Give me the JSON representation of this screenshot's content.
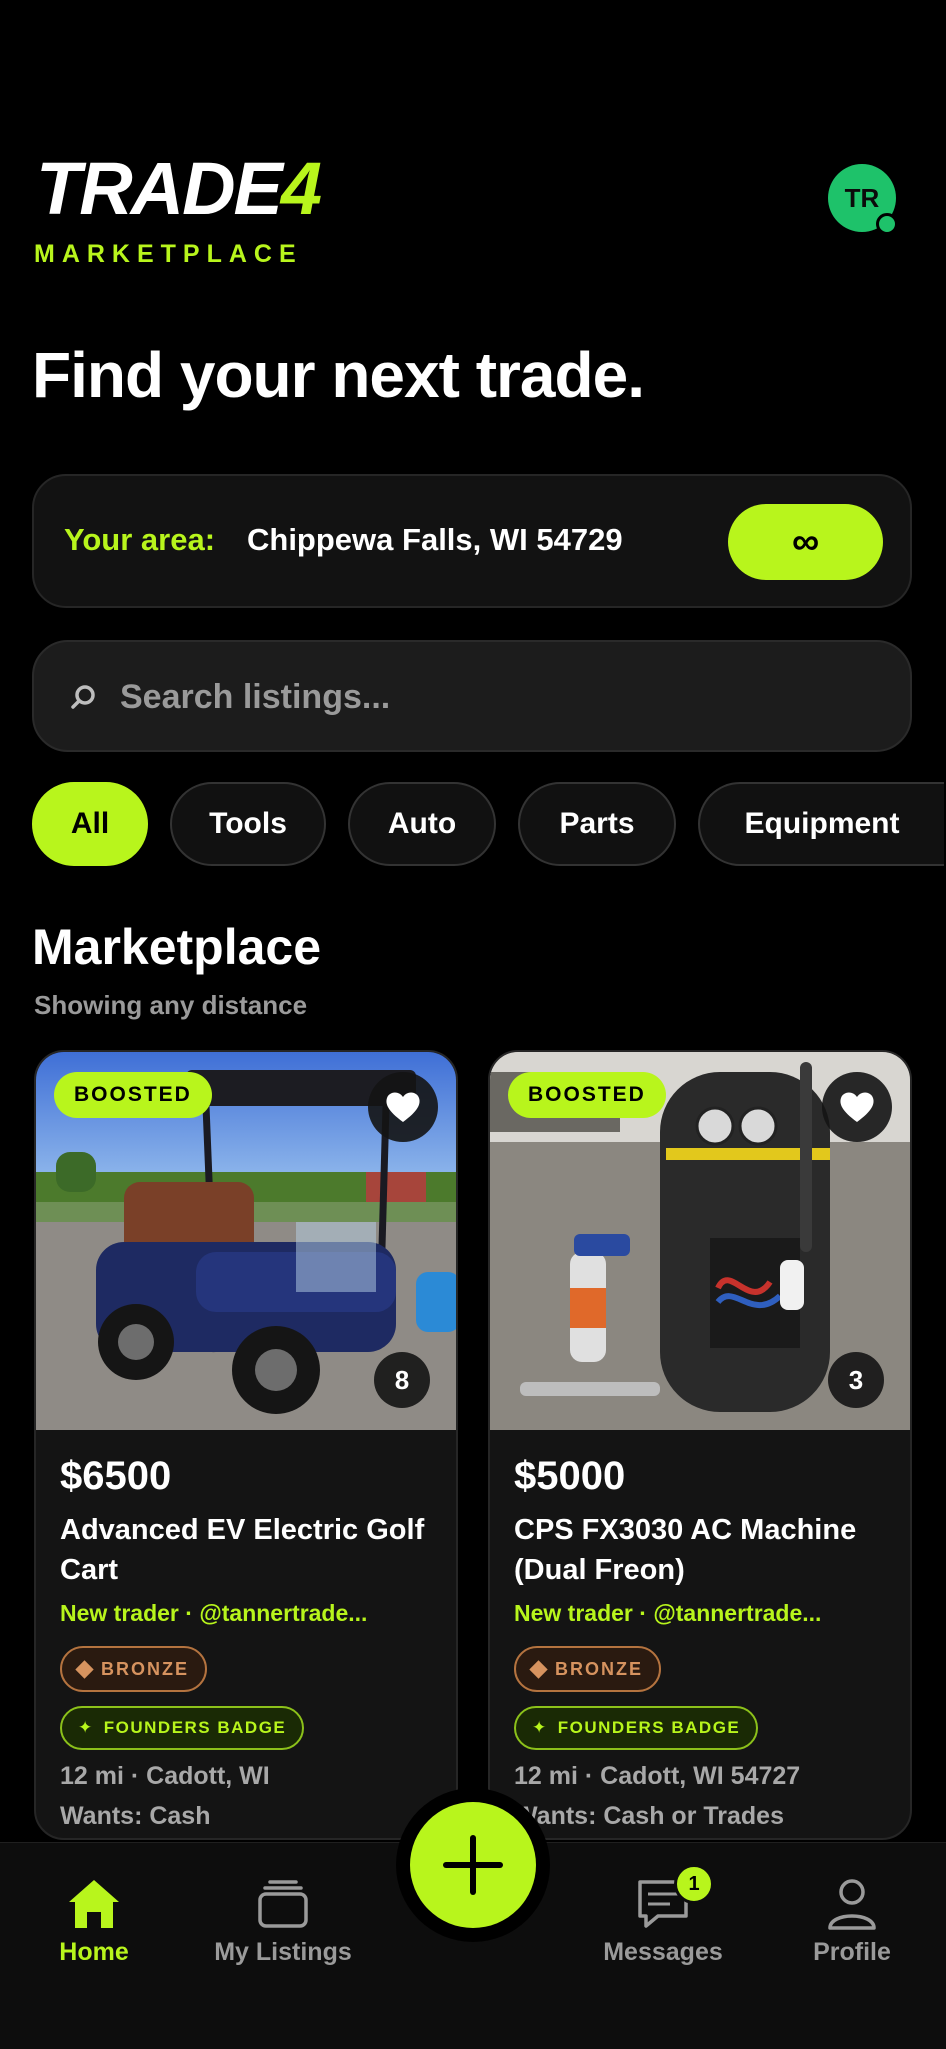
{
  "brand": {
    "name_main": "TRADE",
    "name_accent": "4",
    "subtitle": "MARKETPLACE"
  },
  "user": {
    "initials": "TR"
  },
  "headline": "Find your next trade.",
  "area": {
    "label": "Your area:",
    "value": "Chippewa Falls, WI 54729",
    "distance_symbol": "∞"
  },
  "search": {
    "placeholder": "Search listings..."
  },
  "categories": [
    {
      "label": "All",
      "active": true
    },
    {
      "label": "Tools",
      "active": false
    },
    {
      "label": "Auto",
      "active": false
    },
    {
      "label": "Parts",
      "active": false
    },
    {
      "label": "Equipment",
      "active": false
    }
  ],
  "section": {
    "title": "Marketplace",
    "subtitle": "Showing any distance"
  },
  "listings": [
    {
      "boost_label": "BOOSTED",
      "photo_count": "8",
      "price": "$6500",
      "title": "Advanced EV Electric Golf Cart",
      "trader": "New trader · @tannertrade...",
      "tier_badge": "BRONZE",
      "founders_badge": "FOUNDERS BADGE",
      "location": "12 mi · Cadott, WI",
      "wants": "Wants: Cash"
    },
    {
      "boost_label": "BOOSTED",
      "photo_count": "3",
      "price": "$5000",
      "title": "CPS FX3030 AC Machine (Dual Freon)",
      "trader": "New trader · @tannertrade...",
      "tier_badge": "BRONZE",
      "founders_badge": "FOUNDERS BADGE",
      "location": "12 mi · Cadott, WI 54727",
      "wants": "Wants: Cash or Trades"
    }
  ],
  "nav": {
    "home": "Home",
    "my_listings": "My Listings",
    "messages": "Messages",
    "messages_badge": "1",
    "profile": "Profile"
  },
  "colors": {
    "accent": "#b8f51c",
    "background": "#000000",
    "avatar": "#1ec26a",
    "bronze": "#d6935f"
  }
}
